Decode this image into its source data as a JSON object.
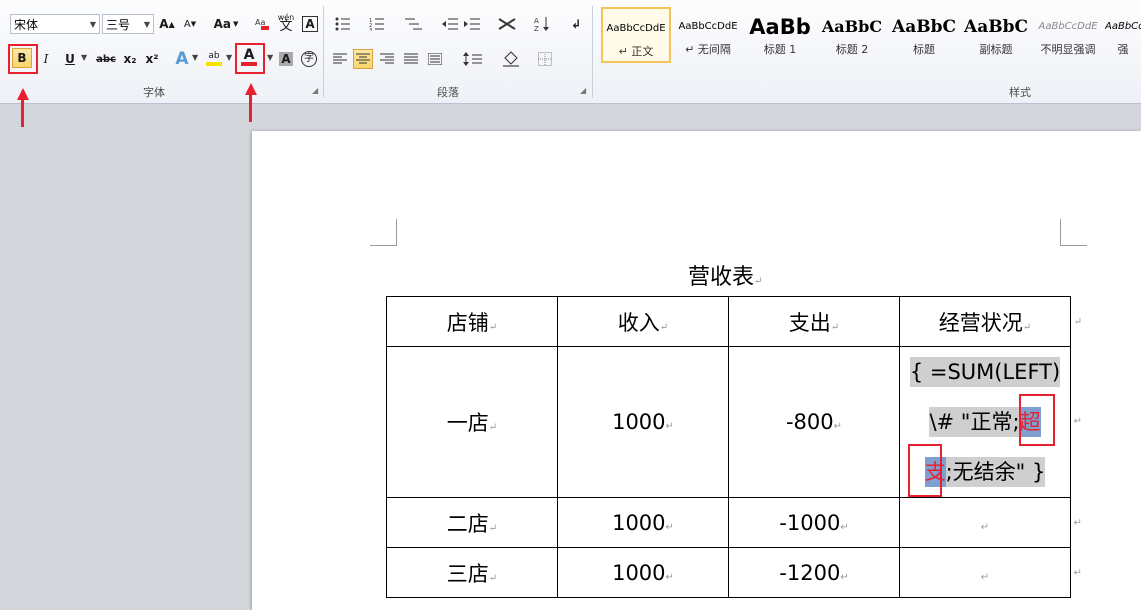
{
  "ribbon": {
    "font_group": {
      "label": "字体",
      "font_name": "宋体",
      "font_size": "三号",
      "grow_font": "A",
      "shrink_font": "A",
      "change_case": "Aa",
      "bold": "B",
      "italic": "I",
      "underline": "U",
      "strikethrough": "abc",
      "subscript": "x₂",
      "superscript": "x²",
      "text_effect": "A",
      "highlight": "ab",
      "font_color": "A",
      "char_shading": "A",
      "enclose_char": "字",
      "phonetic": "wén",
      "phonetic_char": "文",
      "char_border": "A"
    },
    "paragraph_group": {
      "label": "段落"
    },
    "styles_group": {
      "label": "样式",
      "items": [
        {
          "sample": "AaBbCcDdE",
          "name": "↵ 正文"
        },
        {
          "sample": "AaBbCcDdE",
          "name": "↵ 无间隔"
        },
        {
          "sample": "AaBb",
          "name": "标题 1"
        },
        {
          "sample": "AaBbC",
          "name": "标题 2"
        },
        {
          "sample": "AaBbC",
          "name": "标题"
        },
        {
          "sample": "AaBbC",
          "name": "副标题"
        },
        {
          "sample": "AaBbCcDdE",
          "name": "不明显强调"
        },
        {
          "sample": "AaBbCcDdE",
          "name": "强"
        }
      ]
    },
    "colors": {
      "highlight": "#f5e400",
      "font_color": "#e8212f",
      "accent_box": "#e8212f"
    }
  },
  "document": {
    "title": "营收表",
    "para_mark": "↵",
    "table": {
      "headers": [
        "店铺",
        "收入",
        "支出",
        "经营状况"
      ],
      "rows": [
        {
          "store": "一店",
          "income": "1000",
          "expense": "-800"
        },
        {
          "store": "二店",
          "income": "1000",
          "expense": "-1000"
        },
        {
          "store": "三店",
          "income": "1000",
          "expense": "-1200"
        }
      ],
      "field_code": {
        "line1": "{  =SUM(LEFT)",
        "line2_pre": "\\# \"正常;",
        "line2_sel": "超",
        "line3_sel": "支",
        "line3_post": ";无结余\"  }"
      }
    }
  }
}
